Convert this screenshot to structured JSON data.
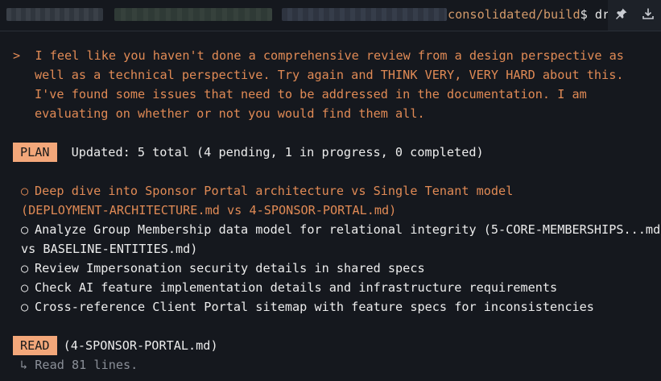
{
  "terminal": {
    "path": "consolidated/build",
    "prompt_symbol": "$ ",
    "command": "dr"
  },
  "toolbar": {
    "pin_icon": "pin-icon",
    "download_icon": "download-icon"
  },
  "user_message": {
    "caret": ">",
    "lines": [
      "I feel like you haven't done a comprehensive review from a design perspective as",
      "well as a technical perspective. Try again and THINK VERY, VERY HARD about this.",
      "I've found some issues that need to be addressed in the documentation. I am",
      "evaluating on whether or not you would find them all."
    ]
  },
  "plan": {
    "badge": "PLAN",
    "summary": "Updated: 5 total (4 pending, 1 in progress, 0 completed)",
    "bullet": "○",
    "tasks": [
      {
        "line1": "Deep dive into Sponsor Portal architecture vs Single Tenant model",
        "line2": "(DEPLOYMENT-ARCHITECTURE.md vs 4-SPONSOR-PORTAL.md)",
        "status": "in_progress"
      },
      {
        "line1": "Analyze Group Membership data model for relational integrity (5-CORE-MEMBERSHIPS...md",
        "line2": "vs BASELINE-ENTITIES.md)",
        "status": "pending"
      },
      {
        "line1": "Review Impersonation security details in shared specs",
        "status": "pending"
      },
      {
        "line1": "Check AI feature implementation details and infrastructure requirements",
        "status": "pending"
      },
      {
        "line1": "Cross-reference Client Portal sitemap with feature specs for inconsistencies",
        "status": "pending"
      }
    ]
  },
  "read": {
    "badge": "READ",
    "file": "(4-SPONSOR-PORTAL.md)",
    "result": "↳ Read 81 lines."
  },
  "colors": {
    "accent": "#e08a55",
    "badge_bg": "#f3a77a",
    "background": "#15181e"
  }
}
